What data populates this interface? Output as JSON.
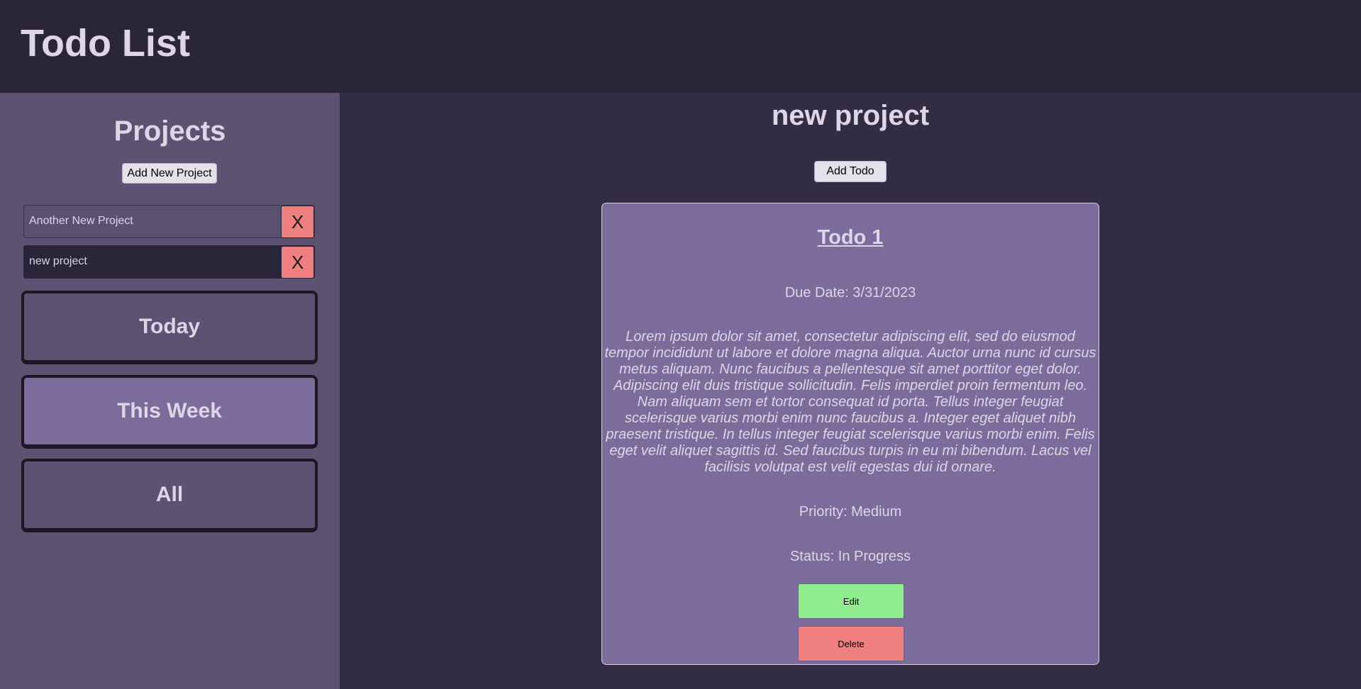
{
  "header": {
    "title": "Todo List"
  },
  "sidebar": {
    "title": "Projects",
    "add_project_label": "Add New Project",
    "projects": [
      {
        "name": "Another New Project",
        "delete_label": "X",
        "selected": false
      },
      {
        "name": "new project",
        "delete_label": "X",
        "selected": true
      }
    ],
    "filters": [
      {
        "label": "Today",
        "active": false
      },
      {
        "label": "This Week",
        "active": true
      },
      {
        "label": "All",
        "active": false
      }
    ]
  },
  "main": {
    "title": "new project",
    "add_todo_label": "Add Todo",
    "todo": {
      "title": "Todo 1",
      "due": "Due Date: 3/31/2023",
      "description": "Lorem ipsum dolor sit amet, consectetur adipiscing elit, sed do eiusmod tempor incididunt ut labore et dolore magna aliqua. Auctor urna nunc id cursus metus aliquam. Nunc faucibus a pellentesque sit amet porttitor eget dolor. Adipiscing elit duis tristique sollicitudin. Felis imperdiet proin fermentum leo. Nam aliquam sem et tortor consequat id porta. Tellus integer feugiat scelerisque varius morbi enim nunc faucibus a. Integer eget aliquet nibh praesent tristique. In tellus integer feugiat scelerisque varius morbi enim. Felis eget velit aliquet sagittis id. Sed faucibus turpis in eu mi bibendum. Lacus vel facilisis volutpat est velit egestas dui id ornare.",
      "priority": "Priority: Medium",
      "status": "Status: In Progress",
      "edit_label": "Edit",
      "delete_label": "Delete"
    }
  },
  "colors": {
    "header_bg": "#2a2538",
    "sidebar_bg": "#5c5272",
    "main_bg": "#332d43",
    "card_bg": "#7b6c9b",
    "edit_green": "#90ee90",
    "delete_red": "#f08080"
  }
}
